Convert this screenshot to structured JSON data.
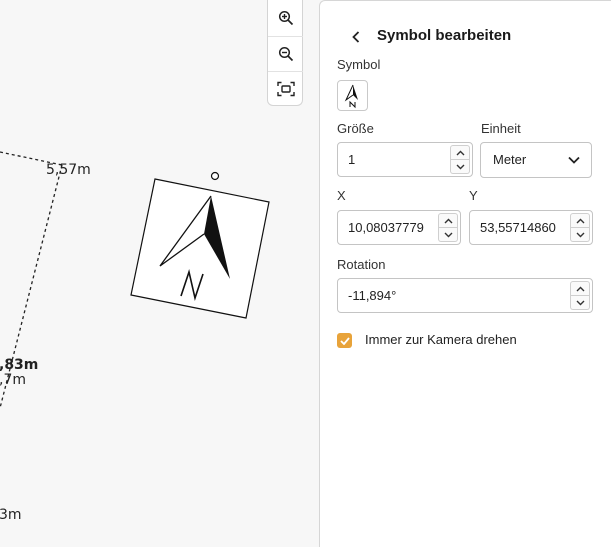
{
  "canvas": {
    "measurements": [
      "5,57m",
      ",83m",
      ",7m",
      "3m"
    ]
  },
  "zoom": {
    "zoom_in_icon": "zoom-in-icon",
    "zoom_out_icon": "zoom-out-icon",
    "fit_icon": "fit-to-screen-icon"
  },
  "panel": {
    "title": "Symbol bearbeiten",
    "symbol_label": "Symbol",
    "size_label": "Größe",
    "size_value": "1",
    "unit_label": "Einheit",
    "unit_value": "Meter",
    "x_label": "X",
    "x_value": "10,08037779",
    "y_label": "Y",
    "y_value": "53,55714860",
    "rotation_label": "Rotation",
    "rotation_value": "-11,894°",
    "checkbox_label": "Immer zur Kamera drehen",
    "checkbox_checked": true,
    "accent_color": "#e8a33a"
  }
}
